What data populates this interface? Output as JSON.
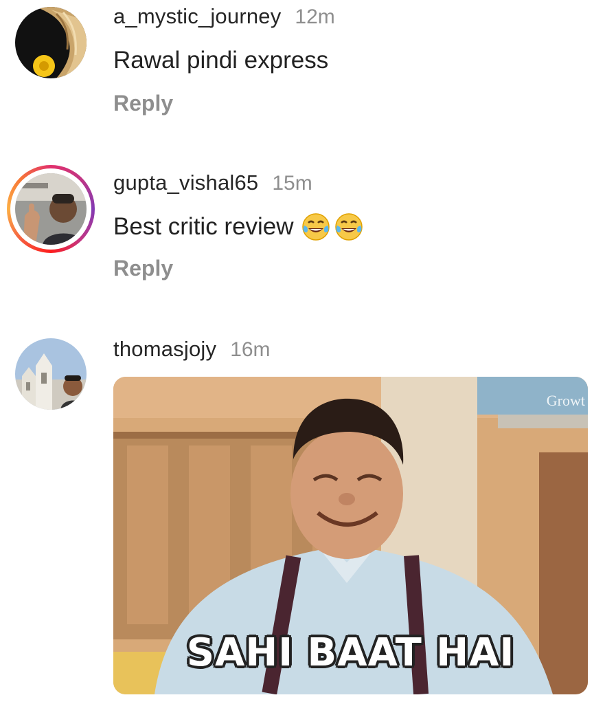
{
  "comments": [
    {
      "username": "a_mystic_journey",
      "time": "12m",
      "text": "Rawal pindi express",
      "reply_label": "Reply",
      "avatar_icon": "avatar-hair-flower"
    },
    {
      "username": "gupta_vishal65",
      "time": "15m",
      "text": "Best critic review",
      "emojis": [
        "face-with-tears-of-joy-icon",
        "face-with-tears-of-joy-icon"
      ],
      "reply_label": "Reply",
      "avatar_icon": "avatar-man-story-ring"
    },
    {
      "username": "thomasjojy",
      "time": "16m",
      "avatar_icon": "avatar-church",
      "gif": {
        "caption": "SAHI BAAT HAI",
        "watermark": "Growt"
      }
    }
  ],
  "colors": {
    "username": "#262626",
    "secondary": "#8e8e8e",
    "story_ring": "#e1306c"
  }
}
